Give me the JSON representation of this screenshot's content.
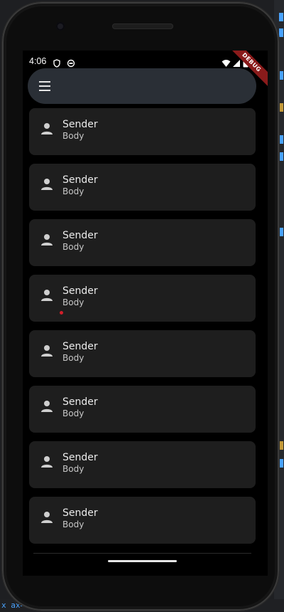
{
  "status_bar": {
    "time": "4:06",
    "icons_left": [
      "shield-icon",
      "cloud-sync-icon"
    ],
    "icons_right": [
      "wifi-icon",
      "signal-icon",
      "battery-icon"
    ]
  },
  "debug_banner": "DEBUG",
  "app_bar": {
    "menu_icon": "hamburger-menu-icon"
  },
  "messages": [
    {
      "sender": "Sender",
      "body": "Body",
      "unread": false
    },
    {
      "sender": "Sender",
      "body": "Body",
      "unread": false
    },
    {
      "sender": "Sender",
      "body": "Body",
      "unread": false
    },
    {
      "sender": "Sender",
      "body": "Body",
      "unread": true
    },
    {
      "sender": "Sender",
      "body": "Body",
      "unread": false
    },
    {
      "sender": "Sender",
      "body": "Body",
      "unread": false
    },
    {
      "sender": "Sender",
      "body": "Body",
      "unread": false
    },
    {
      "sender": "Sender",
      "body": "Body",
      "unread": false
    }
  ],
  "colors": {
    "screen_background": "#000000",
    "app_bar": "#2a2f36",
    "card": "#1e1e1e",
    "unread_dot": "#d21f2a",
    "debug_banner": "#8a1b1b"
  },
  "ide_background": {
    "bottom_text": "x\nax=n"
  }
}
